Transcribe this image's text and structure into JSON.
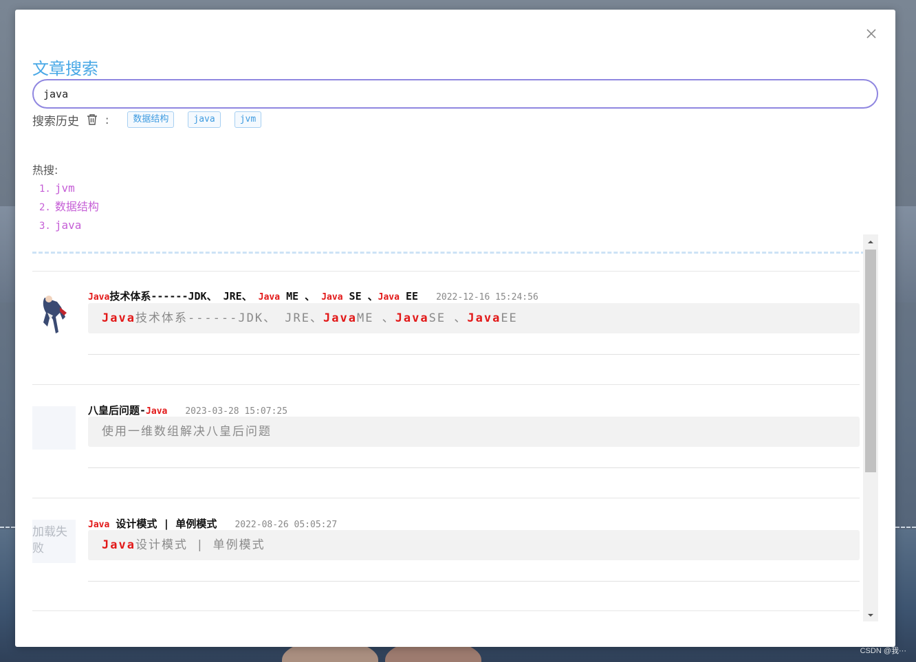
{
  "dialog": {
    "title": "文章搜索",
    "close_icon": "close-icon"
  },
  "search": {
    "value": "java",
    "placeholder": ""
  },
  "history": {
    "label": "搜索历史",
    "colon": ":",
    "clear_icon": "trash-icon",
    "tags": [
      "数据结构",
      "java",
      "jvm"
    ]
  },
  "hot": {
    "label": "热搜:",
    "items": [
      {
        "index": "1.",
        "text": "jvm"
      },
      {
        "index": "2.",
        "text": "数据结构"
      },
      {
        "index": "3.",
        "text": "java"
      }
    ]
  },
  "results": [
    {
      "title_parts": [
        {
          "text": "Java",
          "hl": true
        },
        {
          "text": "技术体系------JDK、 JRE、 ",
          "hl": false
        },
        {
          "text": "Java",
          "hl": true
        },
        {
          "text": " ME 、 ",
          "hl": false
        },
        {
          "text": "Java",
          "hl": true
        },
        {
          "text": " SE 、",
          "hl": false
        },
        {
          "text": "Java",
          "hl": true
        },
        {
          "text": " EE",
          "hl": false
        }
      ],
      "date": "2022-12-16 15:24:56",
      "summary_parts": [
        {
          "text": "Java",
          "hl": true
        },
        {
          "text": "技术体系------JDK、 JRE、",
          "hl": false
        },
        {
          "text": "Java",
          "hl": true
        },
        {
          "text": "ME 、",
          "hl": false
        },
        {
          "text": "Java",
          "hl": true
        },
        {
          "text": "SE 、",
          "hl": false
        },
        {
          "text": "Java",
          "hl": true
        },
        {
          "text": "EE",
          "hl": false
        }
      ],
      "thumb": "image",
      "thumb_text": ""
    },
    {
      "title_parts": [
        {
          "text": "八皇后问题-",
          "hl": false
        },
        {
          "text": "Java",
          "hl": true
        }
      ],
      "date": "2023-03-28 15:07:25",
      "summary_parts": [
        {
          "text": "使用一维数组解决八皇后问题",
          "hl": false
        }
      ],
      "thumb": "blank",
      "thumb_text": ""
    },
    {
      "title_parts": [
        {
          "text": "Java",
          "hl": true
        },
        {
          "text": " 设计模式 | 单例模式",
          "hl": false
        }
      ],
      "date": "2022-08-26 05:05:27",
      "summary_parts": [
        {
          "text": "Java",
          "hl": true
        },
        {
          "text": "设计模式 | 单例模式",
          "hl": false
        }
      ],
      "thumb": "failed",
      "thumb_text": "加载失败"
    }
  ],
  "watermark": "CSDN @我···",
  "colors": {
    "title": "#48a8e6",
    "highlight": "#e21818",
    "hot": "#c55ed6",
    "input_border": "#8f86e0",
    "tag": "#3e9be0"
  }
}
